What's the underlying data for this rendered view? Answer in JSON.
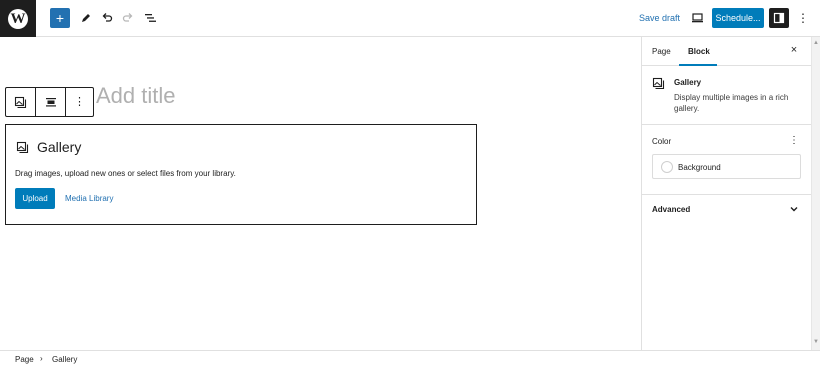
{
  "header": {
    "add_block_label": "+",
    "save_draft_label": "Save draft",
    "schedule_label": "Schedule...",
    "more_label": "⋮"
  },
  "editor": {
    "title_placeholder": "Add title",
    "gallery": {
      "title": "Gallery",
      "instructions": "Drag images, upload new ones or select files from your library.",
      "upload_label": "Upload",
      "media_library_label": "Media Library"
    }
  },
  "sidebar": {
    "tabs": [
      {
        "label": "Page",
        "active": false
      },
      {
        "label": "Block",
        "active": true
      }
    ],
    "close_label": "×",
    "block_card": {
      "title": "Gallery",
      "description": "Display multiple images in a rich gallery."
    },
    "color": {
      "title": "Color",
      "background_label": "Background"
    },
    "advanced": {
      "title": "Advanced"
    }
  },
  "footer": {
    "breadcrumb": [
      "Page",
      "Gallery"
    ]
  },
  "colors": {
    "accent": "#007cba",
    "text": "#1e1e1e",
    "link": "#2271b1",
    "placeholder": "#b0b0b0"
  }
}
